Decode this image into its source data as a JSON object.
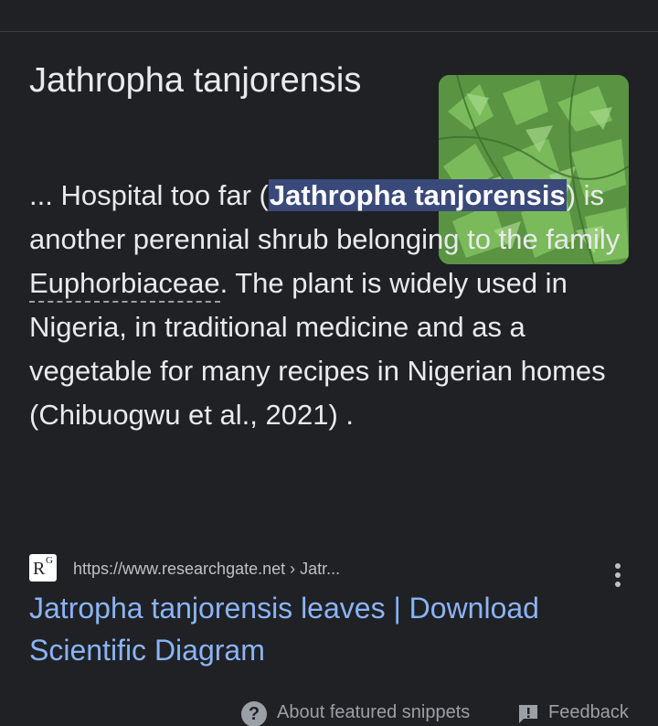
{
  "result": {
    "title": "Jathropha tanjorensis",
    "thumbnail_icon": "plant-leaves-image",
    "snippet": {
      "part1": "... Hospital too far (",
      "highlight": "Jathropha tanjorensis",
      "part2": ") is another perennial shrub belonging to the family ",
      "dotted_term": "Euphorbiaceae",
      "part3": ". The plant is widely used in Nigeria, in traditional medicine and as a vegetable for many recipes in Nigerian homes (Chibuogwu et al., 2021) ."
    },
    "source": {
      "favicon_letter": "R",
      "favicon_sup": "G",
      "url": "https://www.researchgate.net › Jatr..."
    },
    "link_title": "Jatropha tanjorensis leaves | Download Scientific Diagram"
  },
  "footer": {
    "about_label": "About featured snippets",
    "feedback_label": "Feedback"
  },
  "colors": {
    "background": "#202124",
    "link": "#8ab4f8",
    "highlight": "#394a7a"
  }
}
